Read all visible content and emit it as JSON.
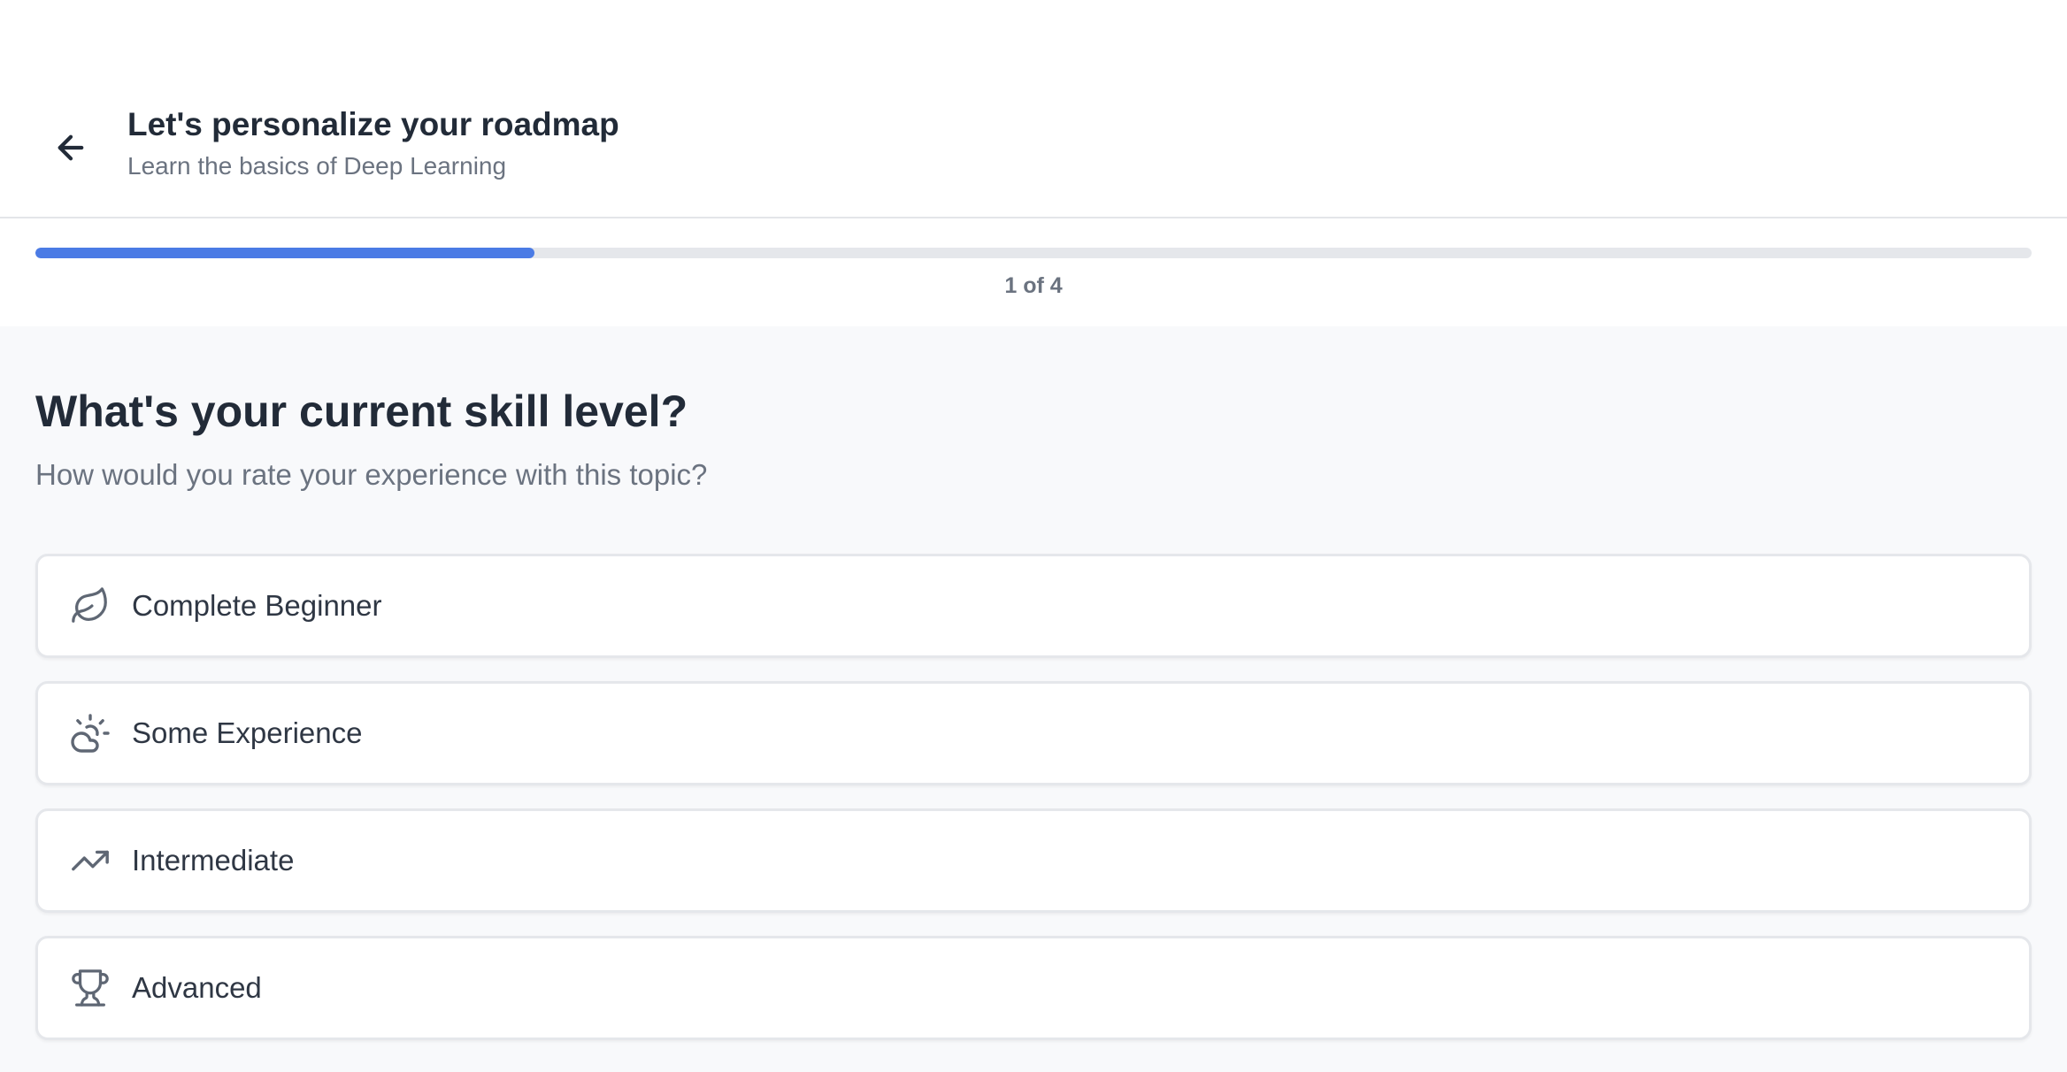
{
  "header": {
    "title": "Let's personalize your roadmap",
    "subtitle": "Learn the basics of Deep Learning"
  },
  "progress": {
    "current_step": 1,
    "total_steps": 4,
    "label": "1 of 4",
    "fraction": 0.25,
    "fill_color": "#4b7be5"
  },
  "question": {
    "title": "What's your current skill level?",
    "subtitle": "How would you rate your experience with this topic?"
  },
  "options": [
    {
      "label": "Complete Beginner",
      "icon": "leaf-icon"
    },
    {
      "label": "Some Experience",
      "icon": "cloud-sun-icon"
    },
    {
      "label": "Intermediate",
      "icon": "trending-up-icon"
    },
    {
      "label": "Advanced",
      "icon": "trophy-icon"
    }
  ],
  "colors": {
    "text_primary": "#222b38",
    "text_secondary": "#6b7380",
    "accent": "#4b7be5",
    "border": "#e5e7eb"
  }
}
